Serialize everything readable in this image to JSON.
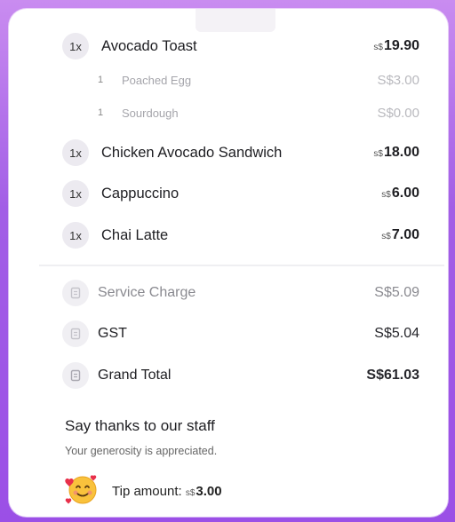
{
  "items": [
    {
      "qty": "1x",
      "name": "Avocado Toast",
      "currency": "s$",
      "amount": "19.90",
      "modifiers": [
        {
          "qty": "1",
          "name": "Poached Egg",
          "price": "S$3.00"
        },
        {
          "qty": "1",
          "name": "Sourdough",
          "price": "S$0.00"
        }
      ]
    },
    {
      "qty": "1x",
      "name": "Chicken Avocado Sandwich",
      "currency": "s$",
      "amount": "18.00"
    },
    {
      "qty": "1x",
      "name": "Cappuccino",
      "currency": "s$",
      "amount": "6.00"
    },
    {
      "qty": "1x",
      "name": "Chai Latte",
      "currency": "s$",
      "amount": "7.00"
    }
  ],
  "summary": [
    {
      "label": "Service Charge",
      "value": "S$5.09"
    },
    {
      "label": "GST",
      "value": "S$5.04"
    },
    {
      "label": "Grand Total",
      "value": "S$61.03"
    }
  ],
  "tipping": {
    "heading": "Say thanks to our staff",
    "note": "Your generosity is appreciated.",
    "label": "Tip amount:",
    "currency": "s$",
    "amount": "3.00",
    "emoji": "smiling-face-with-hearts-icon"
  }
}
